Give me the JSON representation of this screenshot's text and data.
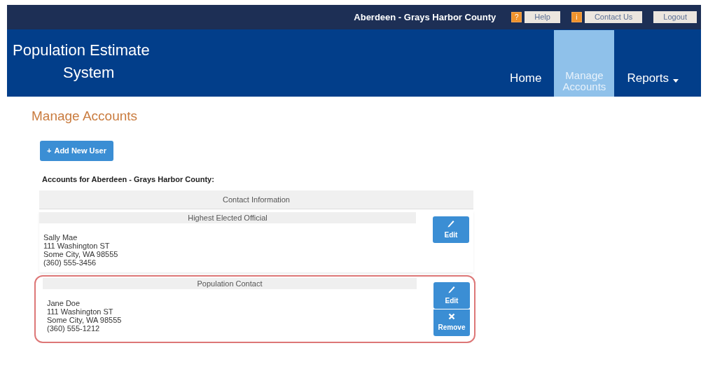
{
  "topbar": {
    "location": "Aberdeen - Grays Harbor County",
    "links": [
      {
        "label": "Help",
        "icon": "?"
      },
      {
        "label": "Contact Us",
        "icon": "i"
      },
      {
        "label": "Logout"
      }
    ]
  },
  "brand": [
    "Population Estimate",
    "System"
  ],
  "nav": [
    {
      "label": "Home",
      "selected": false
    },
    {
      "label": "Manage Accounts",
      "selected": true
    },
    {
      "label": "Reports",
      "selected": false,
      "dropdown": true
    }
  ],
  "page_title": "Manage Accounts",
  "add_button": {
    "icon": "+",
    "label": "Add New User"
  },
  "accounts_heading": "Accounts for Aberdeen - Grays Harbor County:",
  "table_header": "Contact Information",
  "contacts": [
    {
      "role": "Highest Elected Official",
      "highlighted": false,
      "lines": [
        "Sally Mae",
        "111 Washington ST",
        "Some City, WA 98555",
        "(360) 555-3456"
      ],
      "actions": [
        {
          "kind": "edit",
          "label": "Edit"
        }
      ]
    },
    {
      "role": "Population Contact",
      "highlighted": true,
      "lines": [
        "Jane Doe",
        "111 Washington ST",
        "Some City, WA 98555",
        "(360) 555-1212"
      ],
      "actions": [
        {
          "kind": "edit",
          "label": "Edit"
        },
        {
          "kind": "remove",
          "label": "Remove"
        }
      ]
    }
  ]
}
